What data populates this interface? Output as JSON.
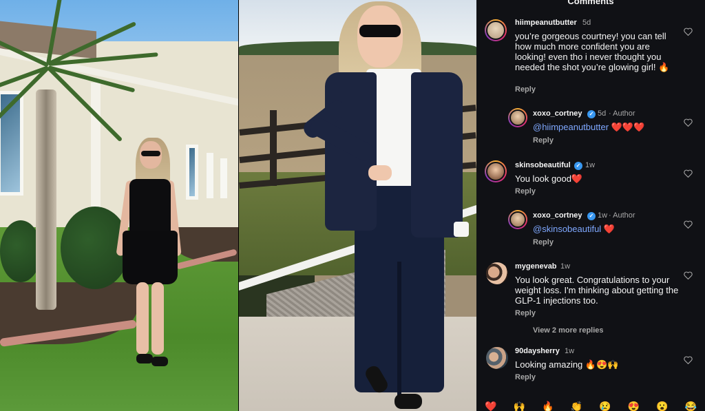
{
  "panel": {
    "title": "Comments"
  },
  "comments": [
    {
      "username": "hiimpeanutbutter",
      "time": "5d",
      "text": "you’re gorgeous courtney! you can tell how much more confident you are looking! even tho i never thought you needed the shot you’re glowing girl! 🔥",
      "reply_label": "Reply"
    },
    {
      "username": "xoxo_cortney",
      "time": "5d",
      "author_label": "· Author",
      "mention": "@hiimpeanutbutter",
      "text": "❤️❤️❤️",
      "reply_label": "Reply"
    },
    {
      "username": "skinsobeautiful",
      "time": "1w",
      "text": "You look good❤️",
      "reply_label": "Reply"
    },
    {
      "username": "xoxo_cortney",
      "time": "1w",
      "author_label": "· Author",
      "mention": "@skinsobeautiful",
      "text": "❤️",
      "reply_label": "Reply"
    },
    {
      "username": "mygenevab",
      "time": "1w",
      "text": "You look great. Congratulations to your weight loss. I'm thinking about getting the GLP-1 injections too.",
      "reply_label": "Reply",
      "view_more": "View 2 more replies"
    },
    {
      "username": "90daysherry",
      "time": "1w",
      "text": "Looking amazing 🔥😍🙌",
      "reply_label": "Reply"
    }
  ],
  "emoji_bar": [
    "❤️",
    "🙌",
    "🔥",
    "👏",
    "😢",
    "😍",
    "😮",
    "😂"
  ],
  "colors": {
    "panel_bg": "#101115",
    "mention": "#7fa8ff",
    "verified": "#3897f0",
    "muted_text": "#a8a8a8"
  }
}
